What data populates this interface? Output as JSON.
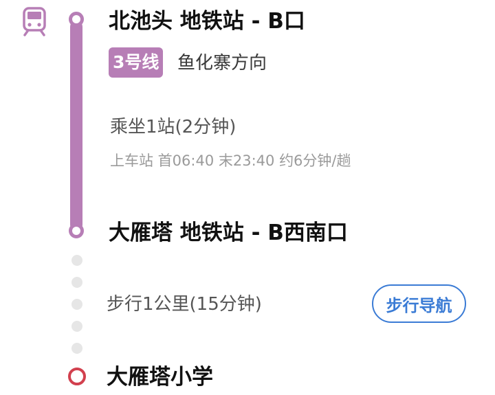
{
  "colors": {
    "line_color": "#b77eb6",
    "dest_color": "#d2404e",
    "accent": "#3a7bd5"
  },
  "icons": {
    "transit_mode": "metro-icon",
    "walk_dots": [
      "walk-dot",
      "walk-dot",
      "walk-dot",
      "walk-dot",
      "walk-dot"
    ]
  },
  "route": {
    "boarding_station": "北池头 地铁站 - B口",
    "line_name": "3号线",
    "direction": "鱼化寨方向",
    "ride_info": "乘坐1站(2分钟)",
    "schedule": "上车站 首06:40  末23:40  约6分钟/趟",
    "alighting_station": "大雁塔 地铁站 - B西南口",
    "walk_info": "步行1公里(15分钟)",
    "walk_nav_label": "步行导航",
    "destination": "大雁塔小学"
  }
}
